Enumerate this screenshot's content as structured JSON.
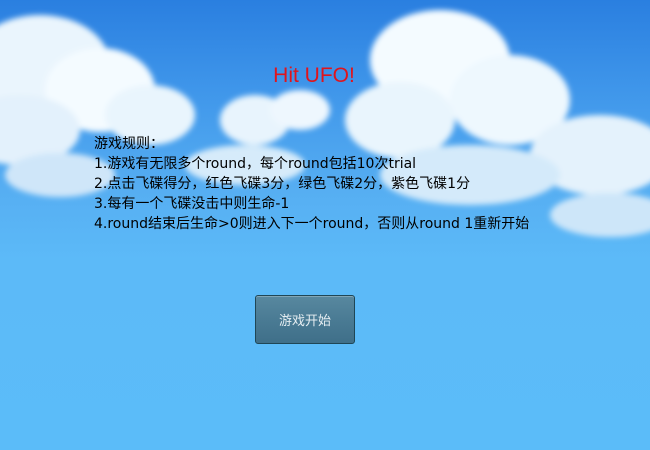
{
  "game": {
    "title": "Hit UFO!",
    "rules": {
      "heading": "游戏规则：",
      "items": [
        "1.游戏有无限多个round，每个round包括10次trial",
        "2.点击飞碟得分，红色飞碟3分，绿色飞碟2分，紫色飞碟1分",
        "3.每有一个飞碟没击中则生命-1",
        "4.round结束后生命>0则进入下一个round，否则从round 1重新开始"
      ]
    },
    "start_button_label": "游戏开始",
    "colors": {
      "title": "#e0141c",
      "sky": "#5bbcf9",
      "button": "#4a7b94"
    }
  }
}
